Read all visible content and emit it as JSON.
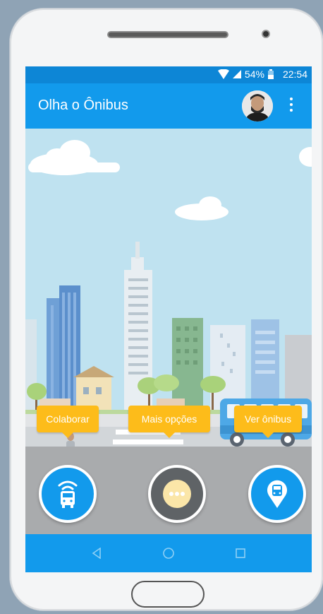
{
  "status": {
    "battery": "54%",
    "time": "22:54"
  },
  "app": {
    "title": "Olha o Ônibus"
  },
  "actions": [
    {
      "label": "Colaborar",
      "icon": "bus-signal-icon"
    },
    {
      "label": "Mais opções",
      "icon": "more-options-icon"
    },
    {
      "label": "Ver ônibus",
      "icon": "bus-location-icon"
    }
  ],
  "colors": {
    "primary": "#129aec",
    "status": "#0d86d6",
    "accent": "#fdbc1a"
  },
  "nav": [
    "back-icon",
    "home-icon",
    "recents-icon"
  ]
}
